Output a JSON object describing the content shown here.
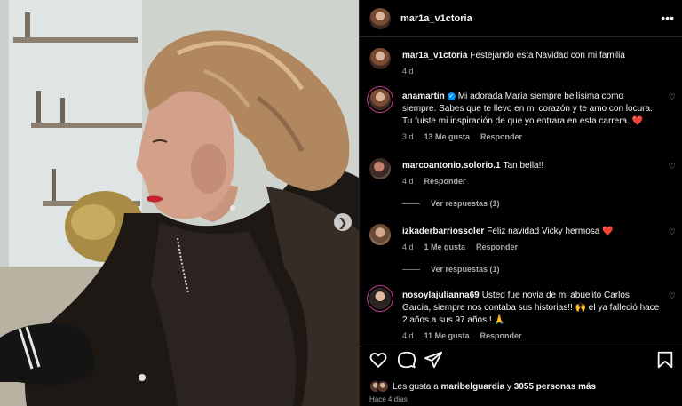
{
  "post": {
    "author": "mar1a_v1ctoria",
    "caption": "Festejando esta Navidad con mi familia",
    "caption_time": "4 d"
  },
  "comments": [
    {
      "username": "anamartin",
      "verified": true,
      "text": "Mi adorada María siempre bellísima como siempre. Sabes que te llevo en mi corazón y te amo con locura. Tu fuiste mi inspiración de que yo entrara en esta carrera.",
      "emoji": "❤️",
      "time": "3 d",
      "likes": "13 Me gusta",
      "reply": "Responder"
    },
    {
      "username": "marcoantonio.solorio.1",
      "text": "Tan bella!!",
      "time": "4 d",
      "reply": "Responder",
      "view_replies": "Ver respuestas (1)"
    },
    {
      "username": "izkaderbarriossoler",
      "text": "Feliz navidad Vicky hermosa",
      "emoji": "❤️",
      "time": "4 d",
      "likes": "1 Me gusta",
      "reply": "Responder",
      "view_replies": "Ver respuestas (1)"
    },
    {
      "username": "nosoylajulianna69",
      "text": "Usted fue novia de mi abuelito Carlos Garcia, siempre nos contaba sus historias!!",
      "text2": "el ya falleció hace 2 años a sus 97 años!!",
      "emoji1": "🙌",
      "emoji2": "🙏",
      "time": "4 d",
      "likes": "11 Me gusta",
      "reply": "Responder"
    }
  ],
  "likes": {
    "prefix": "Les gusta a",
    "user": "maribelguardia",
    "connector": "y",
    "count": "3055 personas más"
  },
  "time_ago": "Hace 4 días",
  "icons": {
    "more": "more-horizontal-icon",
    "like": "heart-icon",
    "comment": "comment-icon",
    "share": "send-icon",
    "save": "bookmark-icon",
    "next": "chevron-right-icon"
  }
}
